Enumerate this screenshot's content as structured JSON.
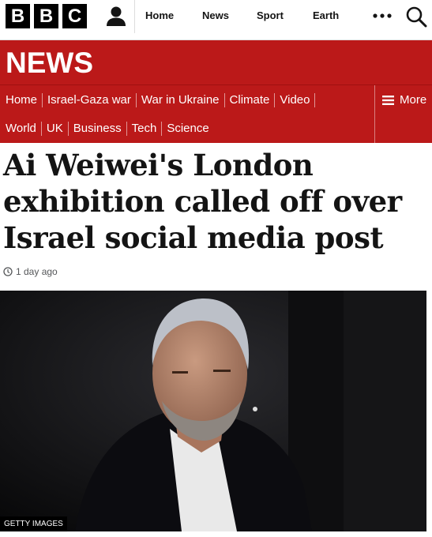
{
  "brand": {
    "letters": [
      "B",
      "B",
      "C"
    ]
  },
  "icons": {
    "account": "user-icon",
    "more": "ellipsis-icon",
    "search": "search-icon",
    "menu": "hamburger-icon",
    "clock": "clock-icon"
  },
  "top_nav": [
    "Home",
    "News",
    "Sport",
    "Earth"
  ],
  "news_band": {
    "title": "NEWS"
  },
  "section_nav": {
    "row1": [
      "Home",
      "Israel-Gaza war",
      "War in Ukraine",
      "Climate",
      "Video"
    ],
    "row2": [
      "World",
      "UK",
      "Business",
      "Tech",
      "Science"
    ],
    "more_label": "More"
  },
  "article": {
    "headline": "Ai Weiwei's London exhibition called off over Israel social media post",
    "timestamp": "1 day ago",
    "image_credit": "GETTY IMAGES"
  },
  "colors": {
    "brand_red": "#bb1919",
    "text": "#141414",
    "meta": "#545658"
  }
}
